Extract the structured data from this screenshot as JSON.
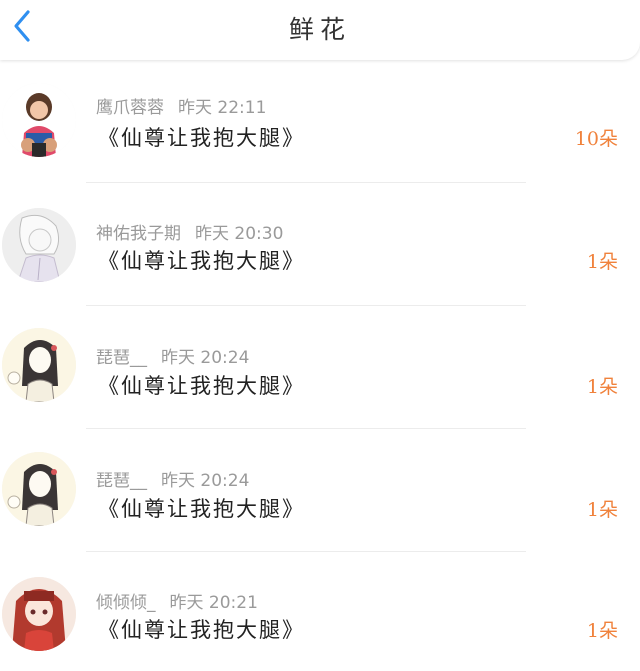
{
  "nav": {
    "title": "鲜花",
    "back_icon": "chevron-left-icon",
    "accent_color": "#2f8ff0"
  },
  "flower_color": "#f0823c",
  "records": [
    {
      "user": "鹰爪蓉蓉",
      "time": "昨天 22:11",
      "novel": "《仙尊让我抱大腿》",
      "amount": "10朵",
      "avatar": "child-photo-avatar"
    },
    {
      "user": "神佑我子期",
      "time": "昨天 20:30",
      "novel": "《仙尊让我抱大腿》",
      "amount": "1朵",
      "avatar": "sketch-anime-avatar"
    },
    {
      "user": "琵琶__",
      "time": "昨天 20:24",
      "novel": "《仙尊让我抱大腿》",
      "amount": "1朵",
      "avatar": "ink-girl-avatar"
    },
    {
      "user": "琵琶__",
      "time": "昨天 20:24",
      "novel": "《仙尊让我抱大腿》",
      "amount": "1朵",
      "avatar": "ink-girl-avatar"
    },
    {
      "user": "倾倾倾_",
      "time": "昨天 20:21",
      "novel": "《仙尊让我抱大腿》",
      "amount": "1朵",
      "avatar": "red-hair-girl-avatar"
    }
  ]
}
